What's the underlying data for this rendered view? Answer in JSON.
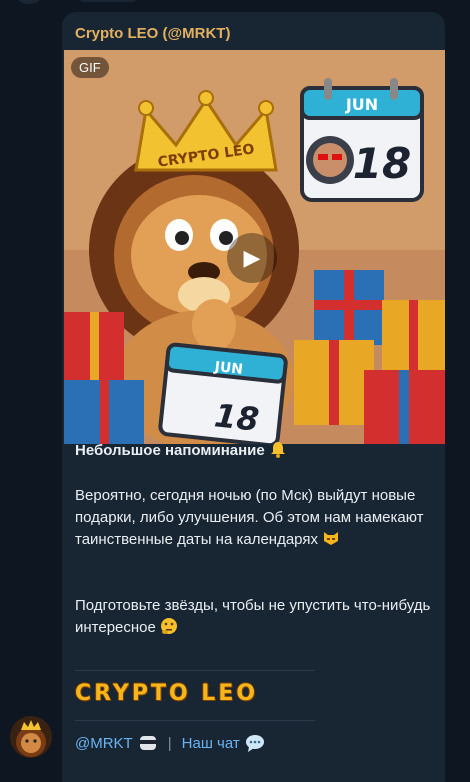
{
  "channel": {
    "sender": "Crypto LEO (@MRKT)",
    "avatar_icon": "lion-crown-avatar"
  },
  "media": {
    "badge": "GIF",
    "crown_text": "CRYPTO LEO",
    "calendar_month": "JUN",
    "calendar_day": "18",
    "small_calendar_month": "JUN",
    "small_calendar_day": "18"
  },
  "post": {
    "title": "Небольшое напоминание",
    "title_emoji": "bell-icon",
    "paragraph1": "Вероятно, сегодня ночью (по Мск) выйдут новые подарки, либо улучшения. Об этом нам намекают таинственные даты на календарях",
    "paragraph1_emoji": "smirk-cat-icon",
    "paragraph2": "Подготовьте звёзды, чтобы не упустить что-нибудь интересное",
    "paragraph2_emoji": "thinking-face-icon",
    "logo_text": "CRYPTO LEO",
    "link_mrkt": "@MRKT",
    "separator": "|",
    "link_chat": "Наш чат"
  },
  "colors": {
    "background": "#0e1621",
    "bubble": "#182533",
    "sender": "#e3b062",
    "link": "#6ab3f3",
    "logo": "#f6b51a"
  }
}
